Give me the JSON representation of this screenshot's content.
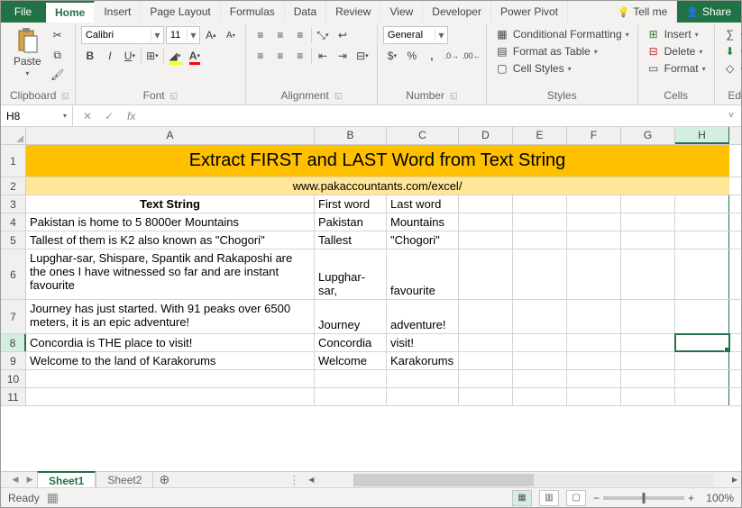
{
  "tabs": {
    "file": "File",
    "home": "Home",
    "insert": "Insert",
    "pagelayout": "Page Layout",
    "formulas": "Formulas",
    "data": "Data",
    "review": "Review",
    "view": "View",
    "developer": "Developer",
    "powerpivot": "Power Pivot",
    "tellme": "Tell me",
    "share": "Share"
  },
  "ribbon": {
    "clipboard": {
      "label": "Clipboard",
      "paste": "Paste"
    },
    "font": {
      "label": "Font",
      "name": "Calibri",
      "size": "11"
    },
    "alignment": {
      "label": "Alignment"
    },
    "number": {
      "label": "Number",
      "format": "General"
    },
    "styles": {
      "label": "Styles",
      "cond": "Conditional Formatting",
      "table": "Format as Table",
      "cell": "Cell Styles"
    },
    "cells": {
      "label": "Cells",
      "insert": "Insert",
      "delete": "Delete",
      "format": "Format"
    },
    "editing": {
      "label": "Editing"
    }
  },
  "namebox": "H8",
  "cols": [
    "A",
    "B",
    "C",
    "D",
    "E",
    "F",
    "G",
    "H"
  ],
  "title": "Extract FIRST and LAST Word from Text String",
  "subtitle": "www.pakaccountants.com/excel/",
  "headers": {
    "a": "Text String",
    "b": "First word",
    "c": "Last word"
  },
  "data": [
    {
      "a": "Pakistan is home to 5 8000er Mountains",
      "b": "Pakistan",
      "c": "Mountains"
    },
    {
      "a": "Tallest of them is K2 also known as \"Chogori\"",
      "b": "Tallest",
      "c": "\"Chogori\""
    },
    {
      "a": "Lupghar-sar, Shispare, Spantik and Rakaposhi are the ones I have witnessed so far and are instant favourite",
      "b": "Lupghar-sar,",
      "c": "favourite"
    },
    {
      "a": "Journey has just started. With 91 peaks over 6500 meters, it is an epic adventure!",
      "b": "Journey",
      "c": "adventure!"
    },
    {
      "a": "Concordia is THE place to visit!",
      "b": "Concordia",
      "c": "visit!"
    },
    {
      "a": "Welcome to the land of Karakorums",
      "b": "Welcome",
      "c": "Karakorums"
    }
  ],
  "sheets": {
    "s1": "Sheet1",
    "s2": "Sheet2"
  },
  "status": {
    "ready": "Ready",
    "zoom": "100%"
  }
}
